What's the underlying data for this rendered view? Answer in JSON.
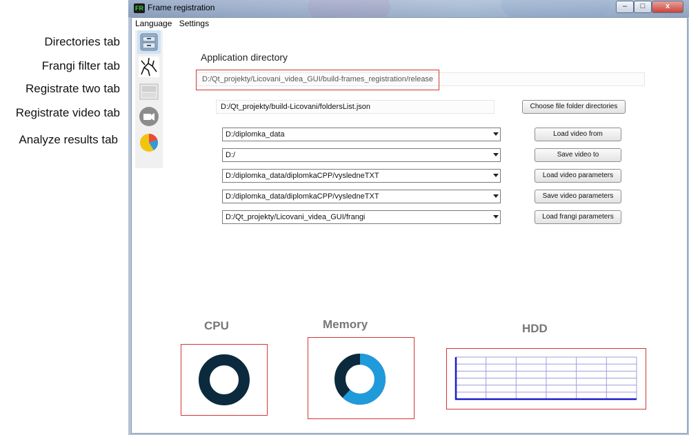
{
  "annotations": {
    "directories": "Directories tab",
    "frangi": "Frangi filter tab",
    "registrate_two": "Registrate two tab",
    "registrate_video": "Registrate video tab",
    "analyze": "Analyze results tab"
  },
  "window": {
    "title": "Frame registration",
    "minimize": "–",
    "maximize": "□",
    "close": "x"
  },
  "menu": {
    "language": "Language",
    "settings": "Settings"
  },
  "main": {
    "app_dir_label": "Application directory",
    "app_dir_path": "D:/Qt_projekty/Licovani_videa_GUI/build-frames_registration/release",
    "folders_list_path": "D:/Qt_projekty/build-Licovani/foldersList.json",
    "choose_button": "Choose file folder directories",
    "rows": [
      {
        "value": "D:/diplomka_data",
        "button": "Load video from"
      },
      {
        "value": "D:/",
        "button": "Save video to"
      },
      {
        "value": "D:/diplomka_data/diplomkaCPP/vysledneTXT",
        "button": "Load video parameters"
      },
      {
        "value": "D:/diplomka_data/diplomkaCPP/vysledneTXT",
        "button": "Save video parameters"
      },
      {
        "value": "D:/Qt_projekty/Licovani_videa_GUI/frangi",
        "button": "Load frangi parameters"
      }
    ]
  },
  "gauges": {
    "cpu": {
      "title": "CPU",
      "used_fraction": 1.0,
      "color": "#0b2a3d"
    },
    "memory": {
      "title": "Memory",
      "used_fraction": 0.62,
      "used_color": "#1f9bdc",
      "free_color": "#0b2a3d"
    },
    "hdd": {
      "title": "HDD"
    }
  },
  "colors": {
    "dark_navy": "#0b2a3d",
    "memory_blue": "#1f9bdc",
    "highlight_red": "#d23434",
    "hdd_axis": "#1a1acc",
    "hdd_grid": "#9d9ddc"
  },
  "icons": {
    "directories": "file-cabinet-icon",
    "frangi": "vessel-filter-icon",
    "registrate_two": "image-stack-icon",
    "registrate_video": "video-camera-icon",
    "analyze": "pie-chart-icon"
  }
}
